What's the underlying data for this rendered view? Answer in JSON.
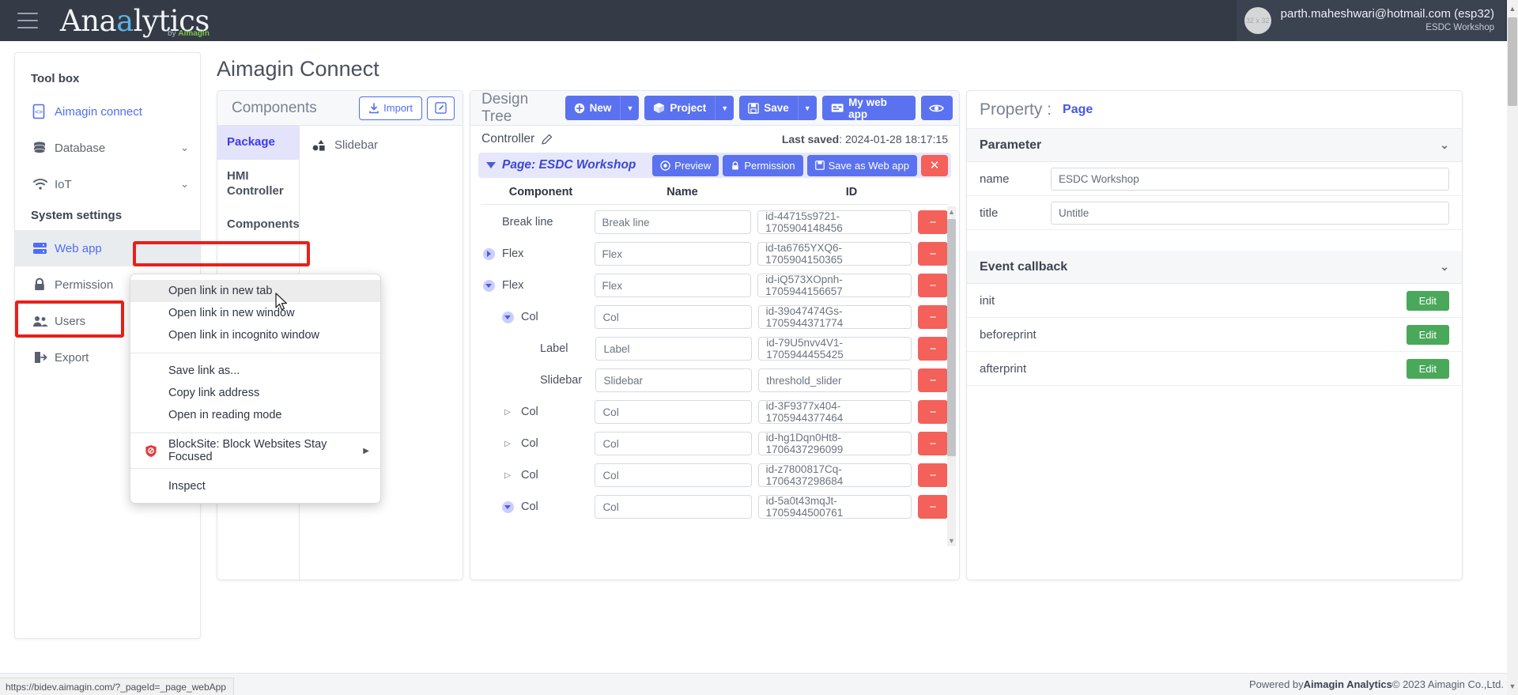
{
  "header": {
    "brand_main": "Ana",
    "brand_accent": "a",
    "brand_rest": "lytics",
    "brand_sub_by": "by ",
    "brand_sub_name": "Aimagin",
    "user_email": "parth.maheshwari@hotmail.com (esp32)",
    "user_org": "ESDC Workshop",
    "avatar_label": "32 x 32"
  },
  "sidebar": {
    "groups": [
      {
        "title": "Tool box",
        "items": [
          {
            "label": "Aimagin connect",
            "icon": "file-code-icon",
            "state": "link",
            "chevron": ""
          },
          {
            "label": "Database",
            "icon": "database-icon",
            "state": "normal",
            "chevron": "⌄"
          },
          {
            "label": "IoT",
            "icon": "wifi-icon",
            "state": "normal",
            "chevron": "⌄"
          }
        ]
      },
      {
        "title": "System settings",
        "items": [
          {
            "label": "Web app",
            "icon": "server-icon",
            "state": "selected",
            "chevron": ""
          },
          {
            "label": "Permission",
            "icon": "lock-icon",
            "state": "normal",
            "chevron": ""
          },
          {
            "label": "Users",
            "icon": "users-icon",
            "state": "normal",
            "chevron": ""
          },
          {
            "label": "Export",
            "icon": "export-icon",
            "state": "normal",
            "chevron": ""
          }
        ]
      }
    ]
  },
  "main": {
    "page_title": "Aimagin Connect"
  },
  "components_panel": {
    "title": "Components",
    "import_label": "Import",
    "edit_icon": "pencil-square-icon",
    "tabs": [
      {
        "label": "Package",
        "active": true
      },
      {
        "label": "HMI Controller",
        "active": false
      },
      {
        "label": "Components",
        "active": false
      }
    ],
    "entries": [
      {
        "label": "Slidebar",
        "icon": "shapes-icon"
      }
    ]
  },
  "design_tree": {
    "title": "Design Tree",
    "toolbar": [
      {
        "label": "New",
        "icon": "plus-circle-icon",
        "caret": true
      },
      {
        "label": "Project",
        "icon": "box-icon",
        "caret": true
      },
      {
        "label": "Save",
        "icon": "floppy-icon",
        "caret": true
      },
      {
        "label": "My web app",
        "icon": "card-icon",
        "caret": false
      }
    ],
    "preview_icon_button": "eye-icon",
    "controller_label": "Controller",
    "controller_edit_icon": "pencil-icon",
    "last_saved_label": "Last saved",
    "last_saved_value": "2024-01-28 18:17:15",
    "page_row": {
      "title": "Page: ESDC Workshop",
      "preview_label": "Preview",
      "permission_label": "Permission",
      "save_as_web_app_label": "Save as Web app",
      "close_label": "✕"
    },
    "columns": [
      "Component",
      "Name",
      "ID"
    ],
    "rows": [
      {
        "component": "Break line",
        "name": "Break line",
        "id": "id-44715s9721-1705904148456",
        "indent": 0,
        "toggle": "none"
      },
      {
        "component": "Flex",
        "name": "Flex",
        "id": "id-ta6765YXQ6-1705904150365",
        "indent": 0,
        "toggle": "collapsed"
      },
      {
        "component": "Flex",
        "name": "Flex",
        "id": "id-iQ573XOpnh-1705944156657",
        "indent": 0,
        "toggle": "expanded"
      },
      {
        "component": "Col",
        "name": "Col",
        "id": "id-39o47474Gs-1705944371774",
        "indent": 1,
        "toggle": "expanded"
      },
      {
        "component": "Label",
        "name": "Label",
        "id": "id-79U5nvv4V1-1705944455425",
        "indent": 2,
        "toggle": "none"
      },
      {
        "component": "Slidebar",
        "name": "Slidebar",
        "id": "threshold_slider",
        "indent": 2,
        "toggle": "none"
      },
      {
        "component": "Col",
        "name": "Col",
        "id": "id-3F9377x404-1705944377464",
        "indent": 1,
        "toggle": "small"
      },
      {
        "component": "Col",
        "name": "Col",
        "id": "id-hg1Dqn0Ht8-1706437296099",
        "indent": 1,
        "toggle": "small"
      },
      {
        "component": "Col",
        "name": "Col",
        "id": "id-z7800817Cq-1706437298684",
        "indent": 1,
        "toggle": "small"
      },
      {
        "component": "Col",
        "name": "Col",
        "id": "id-5a0t43mqJt-1705944500761",
        "indent": 1,
        "toggle": "expanded"
      }
    ]
  },
  "property_panel": {
    "label": "Property :",
    "value": "Page",
    "parameter_section": "Parameter",
    "parameters": [
      {
        "name": "name",
        "value": "ESDC Workshop"
      },
      {
        "name": "title",
        "value": "Untitle"
      }
    ],
    "event_section": "Event callback",
    "events": [
      {
        "name": "init",
        "button": "Edit"
      },
      {
        "name": "beforeprint",
        "button": "Edit"
      },
      {
        "name": "afterprint",
        "button": "Edit"
      }
    ]
  },
  "context_menu": {
    "items": [
      {
        "label": "Open link in new tab",
        "highlighted": true,
        "icon": "",
        "submenu": false
      },
      {
        "label": "Open link in new window",
        "highlighted": false,
        "icon": "",
        "submenu": false
      },
      {
        "label": "Open link in incognito window",
        "highlighted": false,
        "icon": "",
        "submenu": false
      },
      {
        "separator": true
      },
      {
        "label": "Save link as...",
        "highlighted": false,
        "icon": "",
        "submenu": false
      },
      {
        "label": "Copy link address",
        "highlighted": false,
        "icon": "",
        "submenu": false
      },
      {
        "label": "Open in reading mode",
        "highlighted": false,
        "icon": "",
        "submenu": false
      },
      {
        "separator": true
      },
      {
        "label": "BlockSite: Block Websites  Stay Focused",
        "highlighted": false,
        "icon": "blocksite-shield-icon",
        "submenu": true
      },
      {
        "separator": true
      },
      {
        "label": "Inspect",
        "highlighted": false,
        "icon": "",
        "submenu": false
      }
    ]
  },
  "status_bar": {
    "url": "https://bidev.aimagin.com/?_pageId=_page_webApp"
  },
  "footer": {
    "prefix": "Powered by ",
    "brand": "Aimagin Analytics",
    "suffix": " © 2023 Aimagin Co.,Ltd."
  },
  "colors": {
    "accent_blue": "#5a72ef",
    "danger_red": "#f4605a",
    "green": "#4aa85a",
    "highlight_red_box": "#e8201a",
    "topbar": "#343a46"
  }
}
